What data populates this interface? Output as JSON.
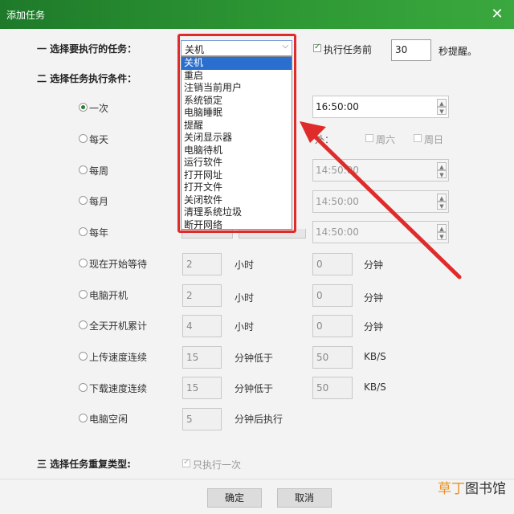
{
  "window": {
    "title": "添加任务",
    "close_glyph": "✕"
  },
  "section1": {
    "label": "一 选择要执行的任务：",
    "select_value": "关机",
    "remind_checkbox_label": "执行任务前",
    "remind_value": "30",
    "remind_suffix": "秒提醒。"
  },
  "dropdown": {
    "items": [
      "关机",
      "重启",
      "注销当前用户",
      "系统锁定",
      "电脑睡眠",
      "提醒",
      "关闭显示器",
      "电脑待机",
      "运行软件",
      "打开网址",
      "打开文件",
      "关闭软件",
      "清理系统垃圾",
      "断开网络"
    ],
    "selected_index": 0
  },
  "section2": {
    "label": "二 选择任务执行条件："
  },
  "conditions": [
    {
      "label": "一次",
      "selected": true
    },
    {
      "label": "每天",
      "selected": false
    },
    {
      "label": "每周",
      "selected": false
    },
    {
      "label": "每月",
      "selected": false
    },
    {
      "label": "每年",
      "selected": false
    },
    {
      "label": "现在开始等待",
      "selected": false
    },
    {
      "label": "电脑开机",
      "selected": false
    },
    {
      "label": "全天开机累计",
      "selected": false
    },
    {
      "label": "上传速度连续",
      "selected": false
    },
    {
      "label": "下载速度连续",
      "selected": false
    },
    {
      "label": "电脑空闲",
      "selected": false
    }
  ],
  "times": {
    "once": "16:50:00",
    "weekly": "14:50:00",
    "monthly": "14:50:00",
    "yearly": "14:50:00"
  },
  "daily_extra": {
    "prefix": "外：",
    "sat": "周六",
    "sun": "周日"
  },
  "wait": {
    "hours": "2",
    "hours_unit": "小时",
    "minutes": "0",
    "minutes_unit": "分钟"
  },
  "boot": {
    "hours": "2",
    "hours_unit": "小时",
    "minutes": "0",
    "minutes_unit": "分钟"
  },
  "uptime": {
    "hours": "4",
    "hours_unit": "小时",
    "minutes": "0",
    "minutes_unit": "分钟"
  },
  "upload": {
    "minutes": "15",
    "text": "分钟低于",
    "speed": "50",
    "unit": "KB/S"
  },
  "download": {
    "minutes": "15",
    "text": "分钟低于",
    "speed": "50",
    "unit": "KB/S"
  },
  "idle": {
    "minutes": "5",
    "text": "分钟后执行"
  },
  "section3": {
    "label": "三 选择任务重复类型:",
    "once_only_label": "只执行一次"
  },
  "buttons": {
    "ok": "确定",
    "cancel": "取消"
  },
  "watermark": {
    "accent": "草丁",
    "rest": "图书馆"
  },
  "colors": {
    "titlebar": "#2f9a35",
    "highlight": "#e02b2b",
    "selection": "#2a6fd0"
  }
}
